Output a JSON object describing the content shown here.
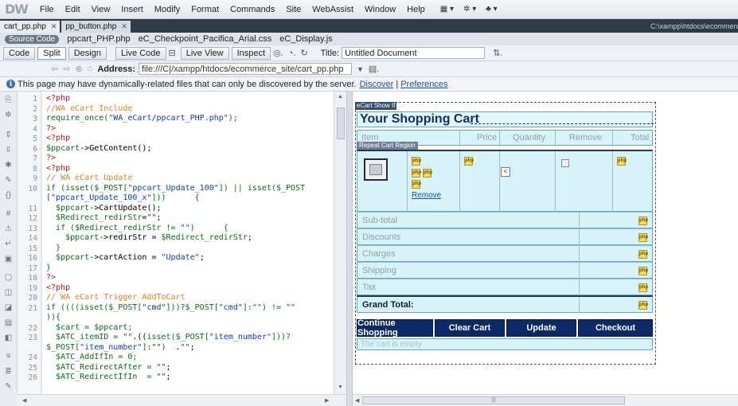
{
  "app": {
    "logo": "DW"
  },
  "menu": [
    "File",
    "Edit",
    "View",
    "Insert",
    "Modify",
    "Format",
    "Commands",
    "Site",
    "WebAssist",
    "Window",
    "Help"
  ],
  "tabs": [
    {
      "label": "cart_pp.php",
      "active": true
    },
    {
      "label": "pp_button.php",
      "active": false
    }
  ],
  "window_path": "C:\\xampp\\htdocs\\ecommerce_site\\cart_pp.php",
  "related_files": [
    "Source Code",
    "ppcart_PHP.php",
    "eC_Checkpoint_Pacifica_Arial.css",
    "eC_Display.js"
  ],
  "toolbar": {
    "code": "Code",
    "split": "Split",
    "design": "Design",
    "live_code": "Live Code",
    "live_view": "Live View",
    "inspect": "Inspect",
    "title_label": "Title:",
    "title_value": "Untitled Document"
  },
  "address": {
    "label": "Address:",
    "value": "file:///C|/xampp/htdocs/ecommerce_site/cart_pp.php"
  },
  "info": {
    "message": "This page may have dynamically-related files that can only be discovered by the server.",
    "discover": "Discover",
    "preferences": "Preferences"
  },
  "code_lines": [
    {
      "n": "1",
      "html": "<span class=\"red\">&lt;?php</span>"
    },
    {
      "n": "2",
      "html": "<span class=\"cm\">//WA eCart Include</span>"
    },
    {
      "n": "3",
      "html": "<span class=\"vr\">require_once(</span><span class=\"s\">\"WA_eCart/ppcart_PHP.php\"</span><span class=\"vr\">);</span>"
    },
    {
      "n": "4",
      "html": "<span class=\"red\">?&gt;</span>"
    },
    {
      "n": "5",
      "html": "<span class=\"red\">&lt;?php</span>"
    },
    {
      "n": "6",
      "html": "<span class=\"vr\">$ppcart</span>-&gt;GetContent();"
    },
    {
      "n": "7",
      "html": "<span class=\"red\">?&gt;</span>"
    },
    {
      "n": "8",
      "html": "<span class=\"red\">&lt;?php</span>"
    },
    {
      "n": "9",
      "html": "<span class=\"cm\">// WA eCart Update</span>"
    },
    {
      "n": "10",
      "html": "<span class=\"vr\">if (isset($_POST[</span><span class=\"s\">\"ppcart_Update_100\"</span><span class=\"vr\">]) || isset($_POST</span>"
    },
    {
      "n": "",
      "html": "<span class=\"vr\">[</span><span class=\"s\">\"ppcart_Update_100_x\"</span><span class=\"vr\">]))</span>      <span class=\"vr\">{</span>"
    },
    {
      "n": "11",
      "html": "  <span class=\"vr\">$ppcart</span>-&gt;CartUpdate();"
    },
    {
      "n": "12",
      "html": "  <span class=\"vr\">$Redirect_redirStr</span>=<span class=\"s\">\"\"</span>;"
    },
    {
      "n": "13",
      "html": "  <span class=\"vr\">if ($Redirect_redirStr != </span><span class=\"s\">\"\"</span><span class=\"vr\">)</span>      <span class=\"vr\">{</span>"
    },
    {
      "n": "14",
      "html": "    <span class=\"vr\">$ppcart</span>-&gt;redirStr = <span class=\"vr\">$Redirect_redirStr</span>;"
    },
    {
      "n": "15",
      "html": "  <span class=\"vr\">}</span>"
    },
    {
      "n": "16",
      "html": "  <span class=\"vr\">$ppcart</span>-&gt;cartAction = <span class=\"s\">\"Update\"</span>;"
    },
    {
      "n": "17",
      "html": "<span class=\"vr\">}</span>"
    },
    {
      "n": "18",
      "html": "<span class=\"red\">?&gt;</span>"
    },
    {
      "n": "19",
      "html": "<span class=\"red\">&lt;?php</span>"
    },
    {
      "n": "20",
      "html": "<span class=\"cm\">// WA eCart Trigger AddToCart</span>"
    },
    {
      "n": "21",
      "html": "<span class=\"vr\">if ((((isset($_POST[</span><span class=\"s\">\"cmd\"</span><span class=\"vr\">]))?$_POST[</span><span class=\"s\">\"cmd\"</span><span class=\"vr\">]:</span><span class=\"s\">\"\"</span><span class=\"vr\">) != </span><span class=\"s\">\"\"</span>"
    },
    {
      "n": "",
      "html": "<span class=\"vr\">)){</span>"
    },
    {
      "n": "22",
      "html": "  <span class=\"vr\">$cart = $ppcart;</span>"
    },
    {
      "n": "23",
      "html": "  <span class=\"vr\">$ATC_itemID = </span><span class=\"s\">\"\"</span>.((<span class=\"vr\">isset($_POST[</span><span class=\"s\">\"item_number\"</span><span class=\"vr\">]))?</span>"
    },
    {
      "n": "",
      "html": "<span class=\"vr\">$_POST[</span><span class=\"s\">\"item_number\"</span><span class=\"vr\">]:</span><span class=\"s\">\"\"</span><span class=\"vr\">)</span>  .<span class=\"s\">\"\"</span>;"
    },
    {
      "n": "24",
      "html": "  <span class=\"vr\">$ATC_AddIfIn = 0;</span>"
    },
    {
      "n": "25",
      "html": "  <span class=\"vr\">$ATC_RedirectAfter = </span><span class=\"s\">\"\"</span>;"
    },
    {
      "n": "26",
      "html": "  <span class=\"vr\">$ATC_RedirectIfIn  = </span><span class=\"s\">\"\"</span>;"
    }
  ],
  "design": {
    "cart_tag": "eCart Show If",
    "repeat_tag": "Repeat Cart Region",
    "title": "Your Shopping Cart",
    "columns": [
      "Item",
      "Price",
      "Quantity",
      "Remove",
      "Total"
    ],
    "remove_link": "Remove",
    "qty_arrow": "<",
    "summary": [
      "Sub-total",
      "Discounts",
      "Charges",
      "Shipping",
      "Tax"
    ],
    "grand_total": "Grand Total:",
    "buttons": [
      "Continue Shopping",
      "Clear Cart",
      "Update",
      "Checkout"
    ],
    "empty_message": "The cart is empty"
  }
}
